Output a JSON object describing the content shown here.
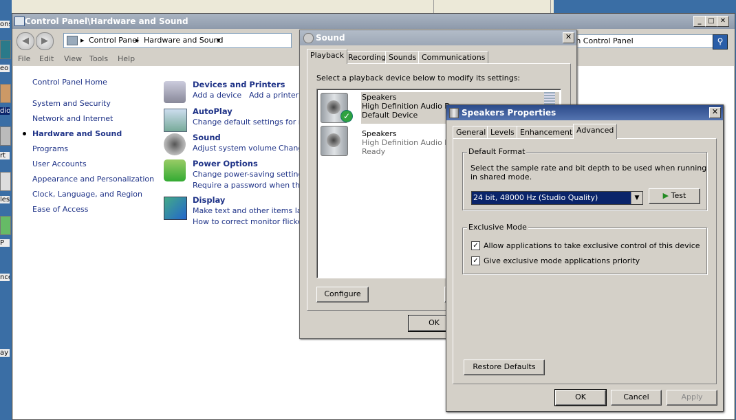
{
  "desktop": {
    "fragments": [
      "ons",
      "eo",
      "dio",
      "rt",
      "les",
      "P",
      "nce",
      "ay t"
    ]
  },
  "control_panel": {
    "title": "Control Panel\\Hardware and Sound",
    "breadcrumb": [
      "Control Panel",
      "Hardware and Sound"
    ],
    "search_placeholder": "rch Control Panel",
    "menu": [
      "File",
      "Edit",
      "View",
      "Tools",
      "Help"
    ],
    "nav": {
      "home": "Control Panel Home",
      "items": [
        "System and Security",
        "Network and Internet",
        "Hardware and Sound",
        "Programs",
        "User Accounts",
        "Appearance and Personalization",
        "Clock, Language, and Region",
        "Ease of Access"
      ]
    },
    "categories": [
      {
        "title": "Devices and Printers",
        "links": [
          "Add a device",
          "Add a printer"
        ]
      },
      {
        "title": "AutoPlay",
        "links": [
          "Change default settings for medi"
        ]
      },
      {
        "title": "Sound",
        "links": [
          "Adjust system volume",
          "Chang"
        ]
      },
      {
        "title": "Power Options",
        "links": [
          "Change power-saving settings",
          "Require a password when the co"
        ]
      },
      {
        "title": "Display",
        "links": [
          "Make text and other items larger",
          "How to correct monitor flicker (re"
        ]
      }
    ]
  },
  "sound_dialog": {
    "title": "Sound",
    "tabs": [
      "Playback",
      "Recording",
      "Sounds",
      "Communications"
    ],
    "instruction": "Select a playback device below to modify its settings:",
    "devices": [
      {
        "name": "Speakers",
        "desc": "High Definition Audio D",
        "status": "Default Device"
      },
      {
        "name": "Speakers",
        "desc": "High Definition Audio D",
        "status": "Ready"
      }
    ],
    "configure": "Configure",
    "ok": "OK"
  },
  "speakers_props": {
    "title": "Speakers Properties",
    "tabs": [
      "General",
      "Levels",
      "Enhancements",
      "Advanced"
    ],
    "default_format": {
      "label": "Default Format",
      "desc_line1": "Select the sample rate and bit depth to be used when running",
      "desc_line2": "in shared mode.",
      "selected": "24 bit, 48000 Hz (Studio Quality)",
      "test": "Test"
    },
    "exclusive": {
      "label": "Exclusive Mode",
      "opt1": "Allow applications to take exclusive control of this device",
      "opt2": "Give exclusive mode applications priority"
    },
    "restore": "Restore Defaults",
    "ok": "OK",
    "cancel": "Cancel",
    "apply": "Apply"
  }
}
